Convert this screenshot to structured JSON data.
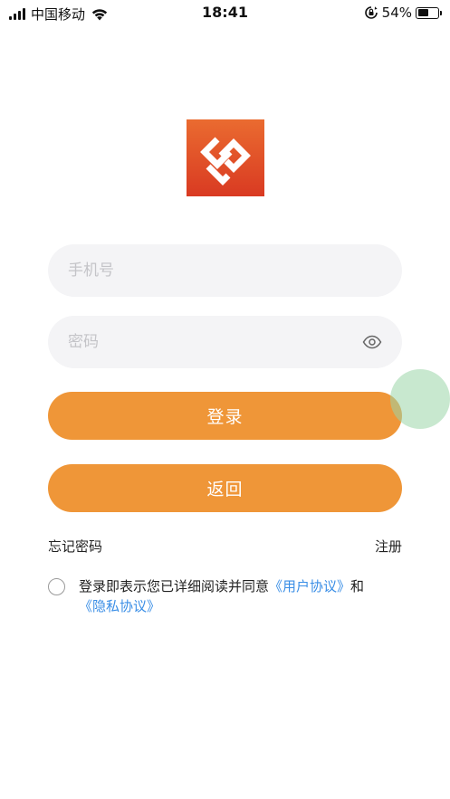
{
  "status_bar": {
    "carrier": "中国移动",
    "time": "18:41",
    "battery_percent": "54%",
    "battery_level": 0.54
  },
  "login_form": {
    "phone_placeholder": "手机号",
    "password_placeholder": "密码",
    "login_label": "登录",
    "back_label": "返回"
  },
  "links": {
    "forgot_password": "忘记密码",
    "register": "注册"
  },
  "agreement": {
    "prefix": "登录即表示您已详细阅读并同意",
    "user_agreement": "《用户协议》",
    "conjunction": "和",
    "privacy_policy": "《隐私协议》",
    "checked": false
  },
  "colors": {
    "accent": "#ef9638",
    "logo_bg": "#e4432a",
    "link": "#3a8ee6",
    "input_bg": "#f4f4f6"
  },
  "icons": [
    "signal-icon",
    "wifi-icon",
    "orientation-lock-icon",
    "battery-icon",
    "app-logo",
    "eye-icon",
    "radio-icon"
  ]
}
